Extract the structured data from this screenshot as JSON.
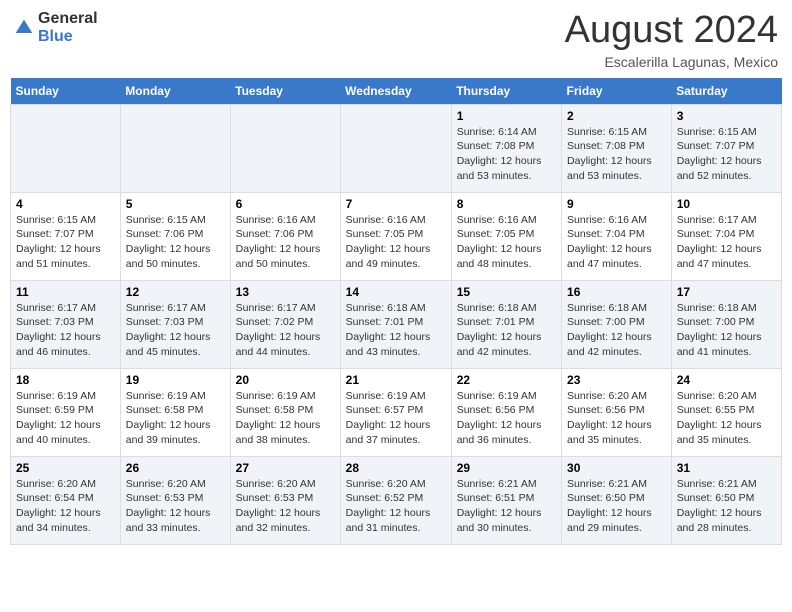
{
  "header": {
    "logo_general": "General",
    "logo_blue": "Blue",
    "month_year": "August 2024",
    "location": "Escalerilla Lagunas, Mexico"
  },
  "days_of_week": [
    "Sunday",
    "Monday",
    "Tuesday",
    "Wednesday",
    "Thursday",
    "Friday",
    "Saturday"
  ],
  "weeks": [
    [
      {
        "day": "",
        "sunrise": "",
        "sunset": "",
        "daylight": ""
      },
      {
        "day": "",
        "sunrise": "",
        "sunset": "",
        "daylight": ""
      },
      {
        "day": "",
        "sunrise": "",
        "sunset": "",
        "daylight": ""
      },
      {
        "day": "",
        "sunrise": "",
        "sunset": "",
        "daylight": ""
      },
      {
        "day": "1",
        "sunrise": "Sunrise: 6:14 AM",
        "sunset": "Sunset: 7:08 PM",
        "daylight": "Daylight: 12 hours and 53 minutes."
      },
      {
        "day": "2",
        "sunrise": "Sunrise: 6:15 AM",
        "sunset": "Sunset: 7:08 PM",
        "daylight": "Daylight: 12 hours and 53 minutes."
      },
      {
        "day": "3",
        "sunrise": "Sunrise: 6:15 AM",
        "sunset": "Sunset: 7:07 PM",
        "daylight": "Daylight: 12 hours and 52 minutes."
      }
    ],
    [
      {
        "day": "4",
        "sunrise": "Sunrise: 6:15 AM",
        "sunset": "Sunset: 7:07 PM",
        "daylight": "Daylight: 12 hours and 51 minutes."
      },
      {
        "day": "5",
        "sunrise": "Sunrise: 6:15 AM",
        "sunset": "Sunset: 7:06 PM",
        "daylight": "Daylight: 12 hours and 50 minutes."
      },
      {
        "day": "6",
        "sunrise": "Sunrise: 6:16 AM",
        "sunset": "Sunset: 7:06 PM",
        "daylight": "Daylight: 12 hours and 50 minutes."
      },
      {
        "day": "7",
        "sunrise": "Sunrise: 6:16 AM",
        "sunset": "Sunset: 7:05 PM",
        "daylight": "Daylight: 12 hours and 49 minutes."
      },
      {
        "day": "8",
        "sunrise": "Sunrise: 6:16 AM",
        "sunset": "Sunset: 7:05 PM",
        "daylight": "Daylight: 12 hours and 48 minutes."
      },
      {
        "day": "9",
        "sunrise": "Sunrise: 6:16 AM",
        "sunset": "Sunset: 7:04 PM",
        "daylight": "Daylight: 12 hours and 47 minutes."
      },
      {
        "day": "10",
        "sunrise": "Sunrise: 6:17 AM",
        "sunset": "Sunset: 7:04 PM",
        "daylight": "Daylight: 12 hours and 47 minutes."
      }
    ],
    [
      {
        "day": "11",
        "sunrise": "Sunrise: 6:17 AM",
        "sunset": "Sunset: 7:03 PM",
        "daylight": "Daylight: 12 hours and 46 minutes."
      },
      {
        "day": "12",
        "sunrise": "Sunrise: 6:17 AM",
        "sunset": "Sunset: 7:03 PM",
        "daylight": "Daylight: 12 hours and 45 minutes."
      },
      {
        "day": "13",
        "sunrise": "Sunrise: 6:17 AM",
        "sunset": "Sunset: 7:02 PM",
        "daylight": "Daylight: 12 hours and 44 minutes."
      },
      {
        "day": "14",
        "sunrise": "Sunrise: 6:18 AM",
        "sunset": "Sunset: 7:01 PM",
        "daylight": "Daylight: 12 hours and 43 minutes."
      },
      {
        "day": "15",
        "sunrise": "Sunrise: 6:18 AM",
        "sunset": "Sunset: 7:01 PM",
        "daylight": "Daylight: 12 hours and 42 minutes."
      },
      {
        "day": "16",
        "sunrise": "Sunrise: 6:18 AM",
        "sunset": "Sunset: 7:00 PM",
        "daylight": "Daylight: 12 hours and 42 minutes."
      },
      {
        "day": "17",
        "sunrise": "Sunrise: 6:18 AM",
        "sunset": "Sunset: 7:00 PM",
        "daylight": "Daylight: 12 hours and 41 minutes."
      }
    ],
    [
      {
        "day": "18",
        "sunrise": "Sunrise: 6:19 AM",
        "sunset": "Sunset: 6:59 PM",
        "daylight": "Daylight: 12 hours and 40 minutes."
      },
      {
        "day": "19",
        "sunrise": "Sunrise: 6:19 AM",
        "sunset": "Sunset: 6:58 PM",
        "daylight": "Daylight: 12 hours and 39 minutes."
      },
      {
        "day": "20",
        "sunrise": "Sunrise: 6:19 AM",
        "sunset": "Sunset: 6:58 PM",
        "daylight": "Daylight: 12 hours and 38 minutes."
      },
      {
        "day": "21",
        "sunrise": "Sunrise: 6:19 AM",
        "sunset": "Sunset: 6:57 PM",
        "daylight": "Daylight: 12 hours and 37 minutes."
      },
      {
        "day": "22",
        "sunrise": "Sunrise: 6:19 AM",
        "sunset": "Sunset: 6:56 PM",
        "daylight": "Daylight: 12 hours and 36 minutes."
      },
      {
        "day": "23",
        "sunrise": "Sunrise: 6:20 AM",
        "sunset": "Sunset: 6:56 PM",
        "daylight": "Daylight: 12 hours and 35 minutes."
      },
      {
        "day": "24",
        "sunrise": "Sunrise: 6:20 AM",
        "sunset": "Sunset: 6:55 PM",
        "daylight": "Daylight: 12 hours and 35 minutes."
      }
    ],
    [
      {
        "day": "25",
        "sunrise": "Sunrise: 6:20 AM",
        "sunset": "Sunset: 6:54 PM",
        "daylight": "Daylight: 12 hours and 34 minutes."
      },
      {
        "day": "26",
        "sunrise": "Sunrise: 6:20 AM",
        "sunset": "Sunset: 6:53 PM",
        "daylight": "Daylight: 12 hours and 33 minutes."
      },
      {
        "day": "27",
        "sunrise": "Sunrise: 6:20 AM",
        "sunset": "Sunset: 6:53 PM",
        "daylight": "Daylight: 12 hours and 32 minutes."
      },
      {
        "day": "28",
        "sunrise": "Sunrise: 6:20 AM",
        "sunset": "Sunset: 6:52 PM",
        "daylight": "Daylight: 12 hours and 31 minutes."
      },
      {
        "day": "29",
        "sunrise": "Sunrise: 6:21 AM",
        "sunset": "Sunset: 6:51 PM",
        "daylight": "Daylight: 12 hours and 30 minutes."
      },
      {
        "day": "30",
        "sunrise": "Sunrise: 6:21 AM",
        "sunset": "Sunset: 6:50 PM",
        "daylight": "Daylight: 12 hours and 29 minutes."
      },
      {
        "day": "31",
        "sunrise": "Sunrise: 6:21 AM",
        "sunset": "Sunset: 6:50 PM",
        "daylight": "Daylight: 12 hours and 28 minutes."
      }
    ]
  ]
}
